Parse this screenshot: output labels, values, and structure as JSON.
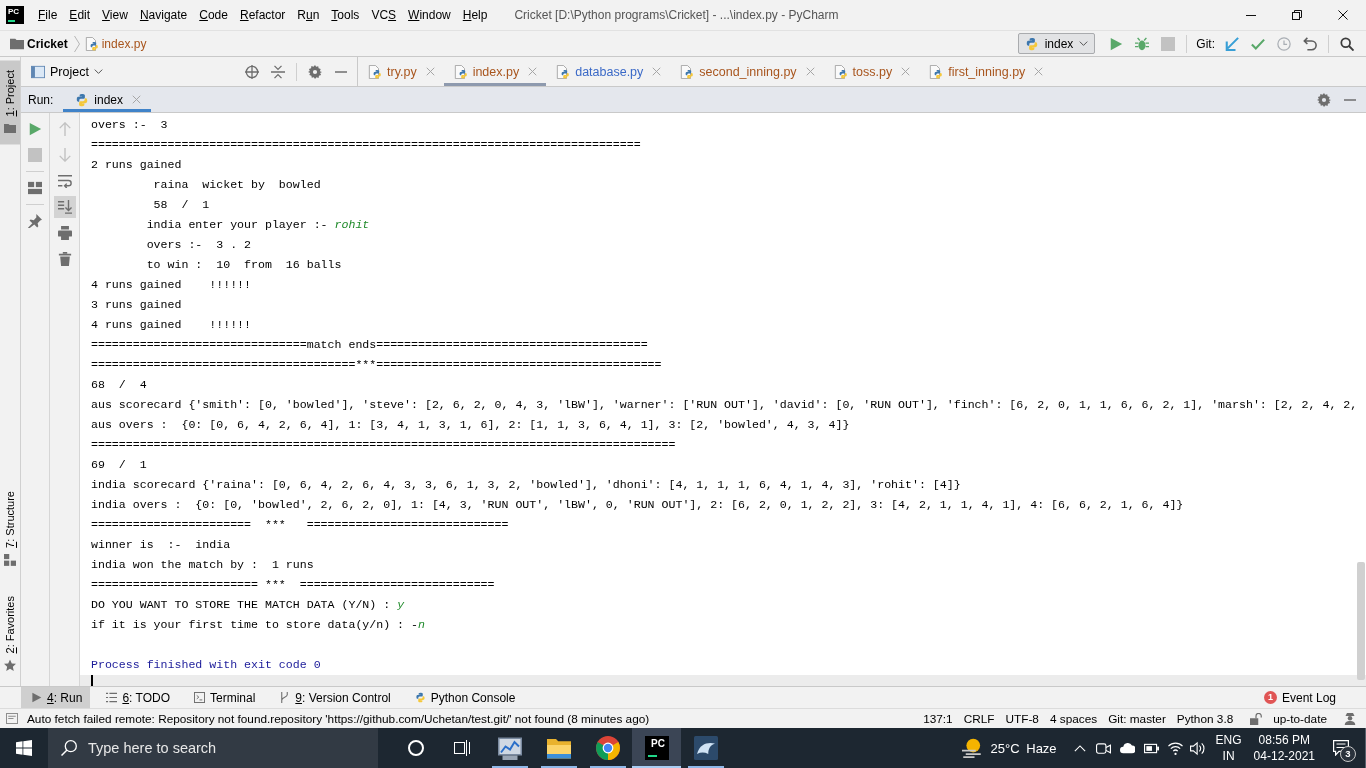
{
  "window": {
    "logo": "PC",
    "title": "Cricket [D:\\Python programs\\Cricket] - ...\\index.py - PyCharm"
  },
  "menu": [
    {
      "key": "F",
      "tail": "ile"
    },
    {
      "key": "E",
      "tail": "dit"
    },
    {
      "key": "V",
      "tail": "iew"
    },
    {
      "key": "N",
      "tail": "avigate"
    },
    {
      "key": "C",
      "tail": "ode"
    },
    {
      "key": "R",
      "tail": "efactor"
    },
    {
      "lead": "R",
      "key": "u",
      "tail": "n"
    },
    {
      "key": "T",
      "tail": "ools"
    },
    {
      "lead": "VC",
      "key": "S"
    },
    {
      "key": "W",
      "tail": "indow"
    },
    {
      "key": "H",
      "tail": "elp"
    }
  ],
  "navigation": {
    "project": "Cricket",
    "file": {
      "name": "index.py",
      "color": "#a8551d"
    },
    "run_config": "index",
    "actions": [
      {
        "kind": "run",
        "disabled": false
      },
      {
        "kind": "debug",
        "disabled": false
      },
      {
        "kind": "stop",
        "disabled": true
      }
    ],
    "vcs_label": "Git:",
    "vcs_actions": [
      {
        "kind": "update"
      },
      {
        "kind": "commit"
      },
      {
        "kind": "history"
      },
      {
        "kind": "rollback"
      }
    ]
  },
  "side_stripe": {
    "top": [
      {
        "key": "1",
        "tail": ": Project",
        "kind": "project",
        "selected": true
      }
    ],
    "bottom": [
      {
        "key": "7",
        "tail": ": Structure",
        "kind": "structure",
        "selected": false
      },
      {
        "key": "2",
        "tail": ": Favorites",
        "kind": "favorites",
        "selected": false
      }
    ]
  },
  "project_panel": {
    "title": "Project"
  },
  "editor_tabs": [
    {
      "name": "try.py",
      "color": "#a8551d",
      "selected": false
    },
    {
      "name": "index.py",
      "color": "#a8551d",
      "selected": true
    },
    {
      "name": "database.py",
      "color": "#3a69c7",
      "selected": false
    },
    {
      "name": "second_inning.py",
      "color": "#a8551d",
      "selected": false
    },
    {
      "name": "toss.py",
      "color": "#a8551d",
      "selected": false
    },
    {
      "name": "first_inning.py",
      "color": "#a8551d",
      "selected": false
    }
  ],
  "run_window": {
    "label": "Run:",
    "tabs": [
      {
        "name": "index",
        "selected": true
      }
    ],
    "toolbar": [
      {
        "kind": "rerun",
        "disabled": false
      },
      {
        "kind": "stop",
        "disabled": true
      },
      {
        "kind": "layout"
      },
      {
        "kind": "pin"
      }
    ],
    "console_toolbar": [
      {
        "kind": "up",
        "disabled": true
      },
      {
        "kind": "down",
        "disabled": true
      },
      {
        "kind": "soft-wrap",
        "selected": false
      },
      {
        "kind": "scroll-to-end",
        "selected": true
      },
      {
        "kind": "print"
      },
      {
        "kind": "clear"
      }
    ],
    "console": [
      {
        "kind": "output",
        "text": "overs :-  3"
      },
      {
        "kind": "output",
        "text": "==============================================================================="
      },
      {
        "kind": "output",
        "text": "2 runs gained"
      },
      {
        "kind": "indented",
        "text": " raina  wicket by  bowled"
      },
      {
        "kind": "indented",
        "text": " 58  /  1"
      },
      {
        "kind": "indented",
        "text": "india enter your player :- ",
        "input": "rohit"
      },
      {
        "kind": "indented",
        "text": "overs :-  3 . 2"
      },
      {
        "kind": "indented",
        "text": "to win :  10  from  16 balls"
      },
      {
        "kind": "output",
        "text": "4 runs gained    !!!!!!"
      },
      {
        "kind": "output",
        "text": "3 runs gained"
      },
      {
        "kind": "output",
        "text": "4 runs gained    !!!!!!"
      },
      {
        "kind": "output",
        "text": "===============================match ends======================================="
      },
      {
        "kind": "output",
        "text": "======================================***========================================="
      },
      {
        "kind": "output",
        "text": "68  /  4"
      },
      {
        "kind": "output",
        "text": "aus scorecard {'smith': [0, 'bowled'], 'steve': [2, 6, 2, 0, 4, 3, 'lBW'], 'warner': ['RUN OUT'], 'david': [0, 'RUN OUT'], 'finch': [6, 2, 0, 1, 1, 6, 6, 2, 1], 'marsh': [2, 2, 4, 2,"
      },
      {
        "kind": "output",
        "text": "aus overs :  {0: [0, 6, 4, 2, 6, 4], 1: [3, 4, 1, 3, 1, 6], 2: [1, 1, 3, 6, 4, 1], 3: [2, 'bowled', 4, 3, 4]}"
      },
      {
        "kind": "output",
        "text": "===================================================================================="
      },
      {
        "kind": "output",
        "text": "69  /  1"
      },
      {
        "kind": "output",
        "text": "india scorecard {'raina': [0, 6, 4, 2, 6, 4, 3, 3, 6, 1, 3, 2, 'bowled'], 'dhoni': [4, 1, 1, 1, 6, 4, 1, 4, 3], 'rohit': [4]}"
      },
      {
        "kind": "output",
        "text": "india overs :  {0: [0, 'bowled', 2, 6, 2, 0], 1: [4, 3, 'RUN OUT', 'lBW', 0, 'RUN OUT'], 2: [6, 2, 0, 1, 2, 2], 3: [4, 2, 1, 1, 4, 1], 4: [6, 6, 2, 1, 6, 4]}"
      },
      {
        "kind": "output",
        "text": "=======================  ***   ============================="
      },
      {
        "kind": "output",
        "text": "winner is  :-  india"
      },
      {
        "kind": "output",
        "text": "india won the match by :  1 runs"
      },
      {
        "kind": "output",
        "text": "======================== ***  ============================"
      },
      {
        "kind": "output",
        "text": "DO YOU WANT TO STORE THE MATCH DATA (Y/N) : ",
        "input": "y"
      },
      {
        "kind": "output",
        "text": "if it is your first time to store data(y/n) : -",
        "input": "n"
      },
      {
        "kind": "exit",
        "text": "Process finished with exit code 0"
      }
    ]
  },
  "tool_windows": [
    {
      "key": "4",
      "tail": ": Run",
      "kind": "run",
      "selected": true
    },
    {
      "key": "6",
      "tail": ": TODO",
      "kind": "todo",
      "selected": false
    },
    {
      "label": "Terminal",
      "kind": "terminal",
      "selected": false
    },
    {
      "key": "9",
      "tail": ": Version Control",
      "kind": "vcs",
      "selected": false
    },
    {
      "label": "Python Console",
      "kind": "python-console",
      "selected": false
    }
  ],
  "event_log": {
    "count": "1",
    "label": "Event Log"
  },
  "status_bar": {
    "message": "Auto fetch failed remote: Repository not found.repository 'https://github.com/Uchetan/test.git/' not found (8 minutes ago)",
    "position": "137:1",
    "line_separator": "CRLF",
    "encoding": "UTF-8",
    "indent": "4 spaces",
    "branch": "Git: master",
    "interpreter": "Python 3.8",
    "vcs_state": "up-to-date"
  },
  "taskbar": {
    "search_placeholder": "Type here to search",
    "apps": [
      {
        "kind": "monitor",
        "running": true,
        "selected": false
      },
      {
        "kind": "explorer",
        "running": true,
        "selected": false
      },
      {
        "kind": "browser",
        "running": true,
        "selected": false
      },
      {
        "kind": "pycharm",
        "label": "PC",
        "running": true,
        "selected": true
      },
      {
        "kind": "workbench",
        "running": true,
        "selected": false
      }
    ],
    "weather": "25°C Haze",
    "language": "ENG",
    "region": "IN",
    "time": "08:56 PM",
    "date": "04-12-2021",
    "notifications": "3"
  }
}
